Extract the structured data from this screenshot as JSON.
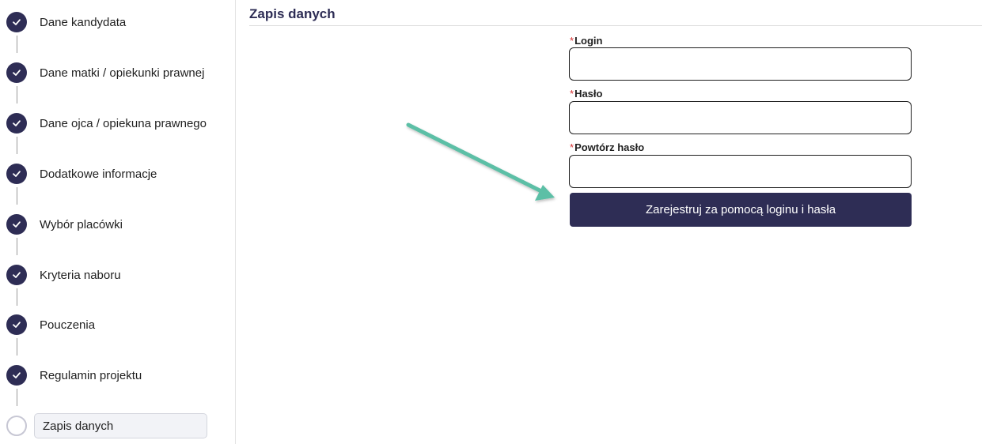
{
  "sidebar": {
    "steps": [
      {
        "label": "Dane kandydata",
        "status": "done"
      },
      {
        "label": "Dane matki / opiekunki prawnej",
        "status": "done"
      },
      {
        "label": "Dane ojca / opiekuna prawnego",
        "status": "done"
      },
      {
        "label": "Dodatkowe informacje",
        "status": "done"
      },
      {
        "label": "Wybór placówki",
        "status": "done"
      },
      {
        "label": "Kryteria naboru",
        "status": "done"
      },
      {
        "label": "Pouczenia",
        "status": "done"
      },
      {
        "label": "Regulamin projektu",
        "status": "done"
      },
      {
        "label": "Zapis danych",
        "status": "current"
      }
    ]
  },
  "main": {
    "title": "Zapis danych",
    "required_marker": "*",
    "login": {
      "label": "Login",
      "value": ""
    },
    "password": {
      "label": "Hasło",
      "value": ""
    },
    "password_repeat": {
      "label": "Powtórz hasło",
      "value": ""
    },
    "submit_label": "Zarejestruj za pomocą loginu i hasła"
  },
  "colors": {
    "accent": "#2e2d55",
    "required": "#d63031",
    "annotation_arrow": "#5cbfa6"
  }
}
